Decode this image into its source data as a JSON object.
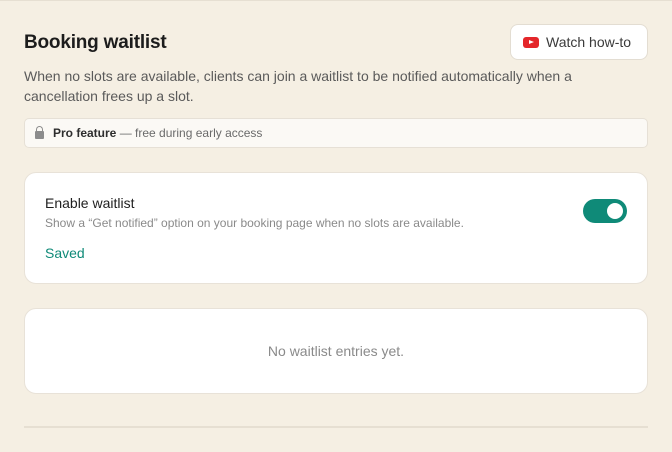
{
  "header": {
    "title": "Booking waitlist",
    "howto_label": "Watch how-to",
    "howto_icon": "youtube-play-icon"
  },
  "description": "When no slots are available, clients can join a waitlist to be notified automatically when a cancellation frees up a slot.",
  "pro_banner": {
    "icon": "lock-icon",
    "strong": "Pro feature",
    "text": "— free during early access"
  },
  "waitlist_setting": {
    "title": "Enable waitlist",
    "description": "Show a “Get notified” option on your booking page when no slots are available.",
    "enabled": true,
    "status": "Saved"
  },
  "entries": {
    "empty_text": "No waitlist entries yet."
  },
  "colors": {
    "background": "#f5efe3",
    "accent": "#0f8a78",
    "youtube": "#e4262a"
  }
}
